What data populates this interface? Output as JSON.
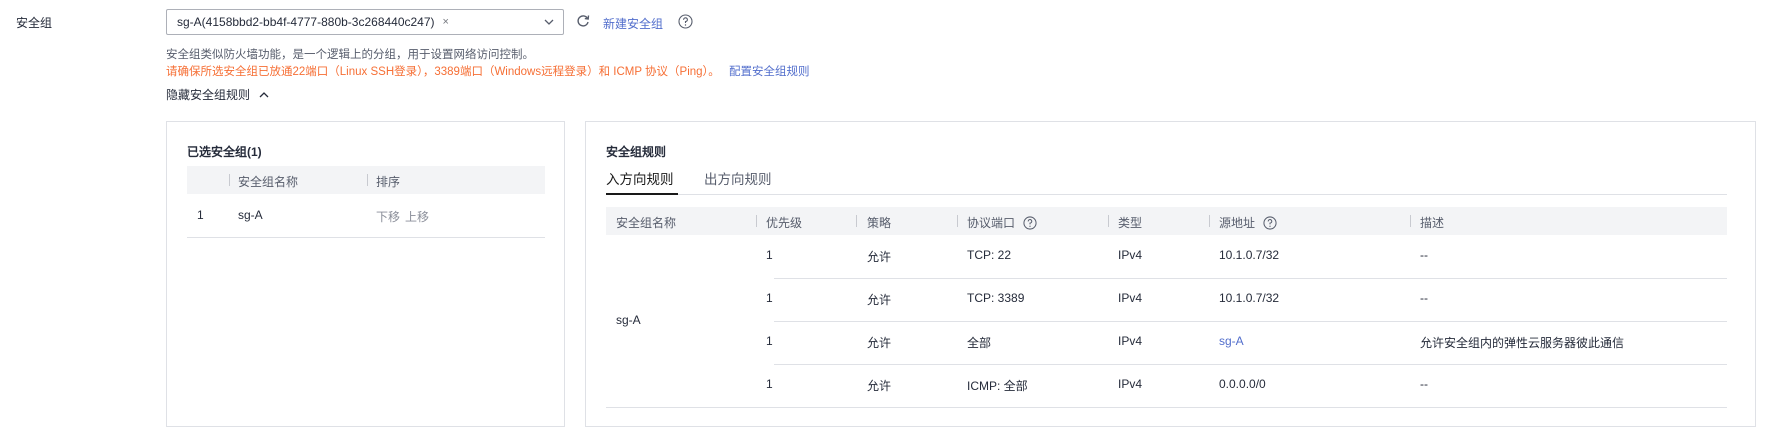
{
  "field": {
    "label": "安全组"
  },
  "select": {
    "tag": "sg-A(4158bbd2-bb4f-4777-880b-3c268440c247)",
    "tag_close": "×"
  },
  "actions": {
    "new_sg": "新建安全组"
  },
  "description": "安全组类似防火墙功能，是一个逻辑上的分组，用于设置网络访问控制。",
  "warning": {
    "text": "请确保所选安全组已放通22端口（Linux SSH登录），3389端口（Windows远程登录）和 ICMP 协议（Ping）。",
    "link": "配置安全组规则"
  },
  "toggle": {
    "label": "隐藏安全组规则"
  },
  "selected_panel": {
    "title": "已选安全组(1)",
    "columns": [
      "安全组名称",
      "排序"
    ],
    "rows": [
      {
        "index": "1",
        "name": "sg-A",
        "down": "下移",
        "up": "上移"
      }
    ]
  },
  "rules_panel": {
    "title": "安全组规则",
    "tabs": [
      "入方向规则",
      "出方向规则"
    ],
    "columns": [
      "安全组名称",
      "优先级",
      "策略",
      "协议端口",
      "类型",
      "源地址",
      "描述"
    ],
    "group_name": "sg-A",
    "rows": [
      {
        "priority": "1",
        "policy": "允许",
        "port": "TCP: 22",
        "type": "IPv4",
        "source": "10.1.0.7/32",
        "desc": "--"
      },
      {
        "priority": "1",
        "policy": "允许",
        "port": "TCP: 3389",
        "type": "IPv4",
        "source": "10.1.0.7/32",
        "desc": "--"
      },
      {
        "priority": "1",
        "policy": "允许",
        "port": "全部",
        "type": "IPv4",
        "source": "sg-A",
        "desc": "允许安全组内的弹性云服务器彼此通信"
      },
      {
        "priority": "1",
        "policy": "允许",
        "port": "ICMP: 全部",
        "type": "IPv4",
        "source": "0.0.0.0/0",
        "desc": "--"
      }
    ]
  },
  "colors": {
    "link": "#526ecc",
    "warning": "#f66f35",
    "header_bg": "#f3f4f6",
    "border": "#dfe1e6"
  }
}
